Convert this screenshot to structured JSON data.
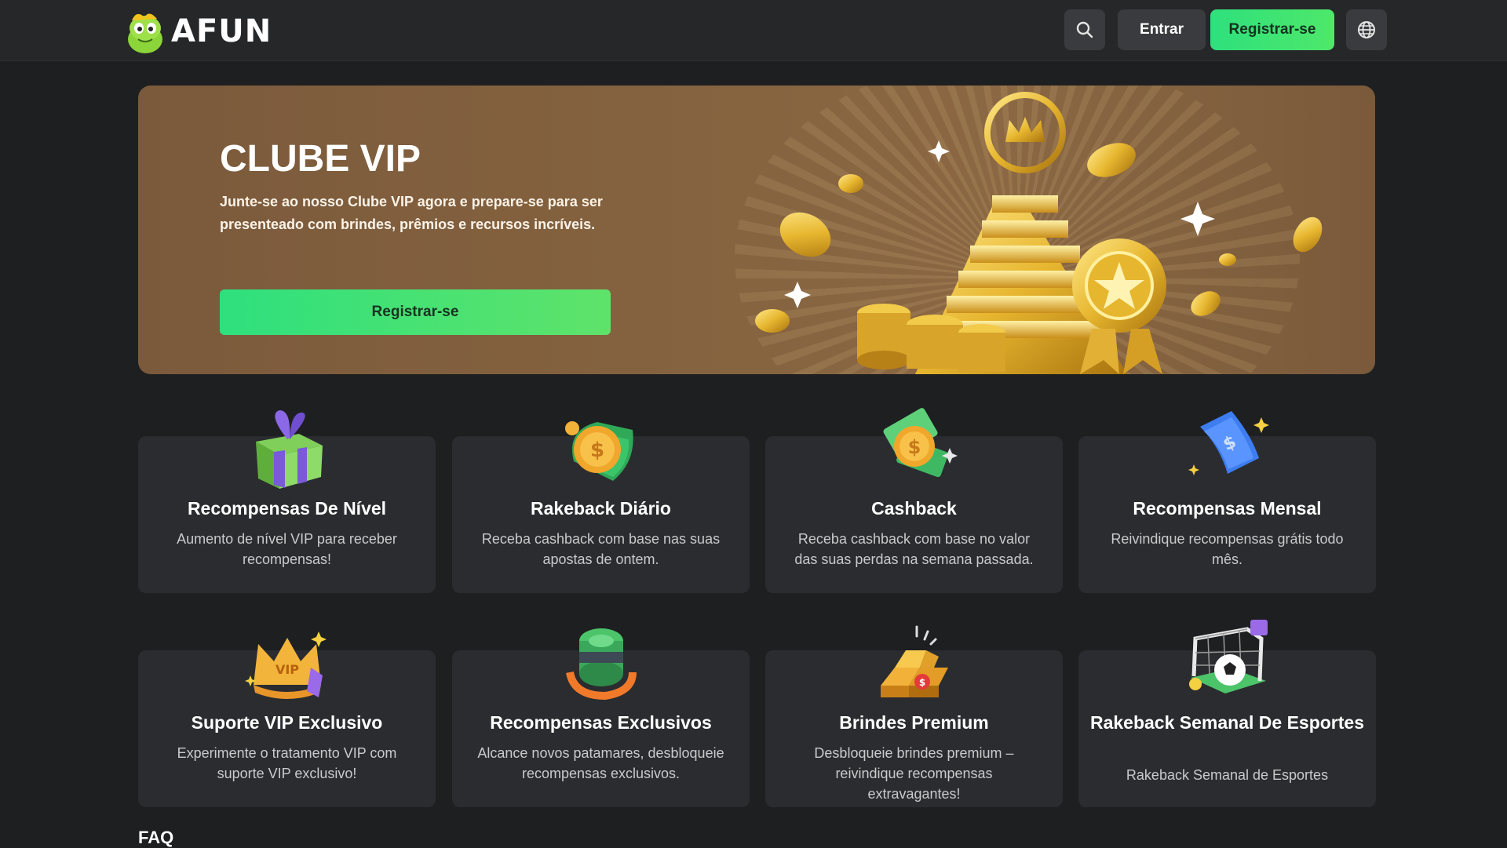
{
  "header": {
    "logo_text": "AFUN",
    "login_label": "Entrar",
    "register_label": "Registrar-se",
    "icons": [
      "search-icon",
      "globe-icon"
    ]
  },
  "hero": {
    "title": "CLUBE VIP",
    "description": "Junte-se ao nosso Clube VIP agora e prepare-se para ser presenteado com brindes, prêmios e recursos incríveis.",
    "cta_label": "Registrar-se"
  },
  "cards": [
    {
      "title": "Recompensas De Nível",
      "desc": "Aumento de nível VIP para receber recompensas!",
      "icon": "gift-icon"
    },
    {
      "title": "Rakeback Diário",
      "desc": "Receba cashback com base nas suas apostas de ontem.",
      "icon": "coin-cash-icon"
    },
    {
      "title": "Cashback",
      "desc": "Receba cashback com base no valor das suas perdas na semana passada.",
      "icon": "cashback-icon"
    },
    {
      "title": "Recompensas Mensal",
      "desc": "Reivindique recompensas grátis todo mês.",
      "icon": "banknote-icon"
    },
    {
      "title": "Suporte VIP Exclusivo",
      "desc": "Experimente o tratamento VIP com suporte VIP exclusivo!",
      "icon": "vip-crown-icon"
    },
    {
      "title": "Recompensas Exclusivos",
      "desc": "Alcance novos patamares, desbloqueie recompensas exclusivos.",
      "icon": "cash-roll-icon"
    },
    {
      "title": "Brindes Premium",
      "desc": "Desbloqueie brindes premium – reivindique recompensas extravagantes!",
      "icon": "gold-bars-icon"
    },
    {
      "title": "Rakeback Semanal De Esportes",
      "desc": "Rakeback Semanal de Esportes",
      "icon": "soccer-goal-icon"
    }
  ],
  "faq_title": "FAQ",
  "colors": {
    "accent": "#2ee07d",
    "background": "#1e1f21",
    "card": "#2b2c2f",
    "hero": "#84623f"
  }
}
